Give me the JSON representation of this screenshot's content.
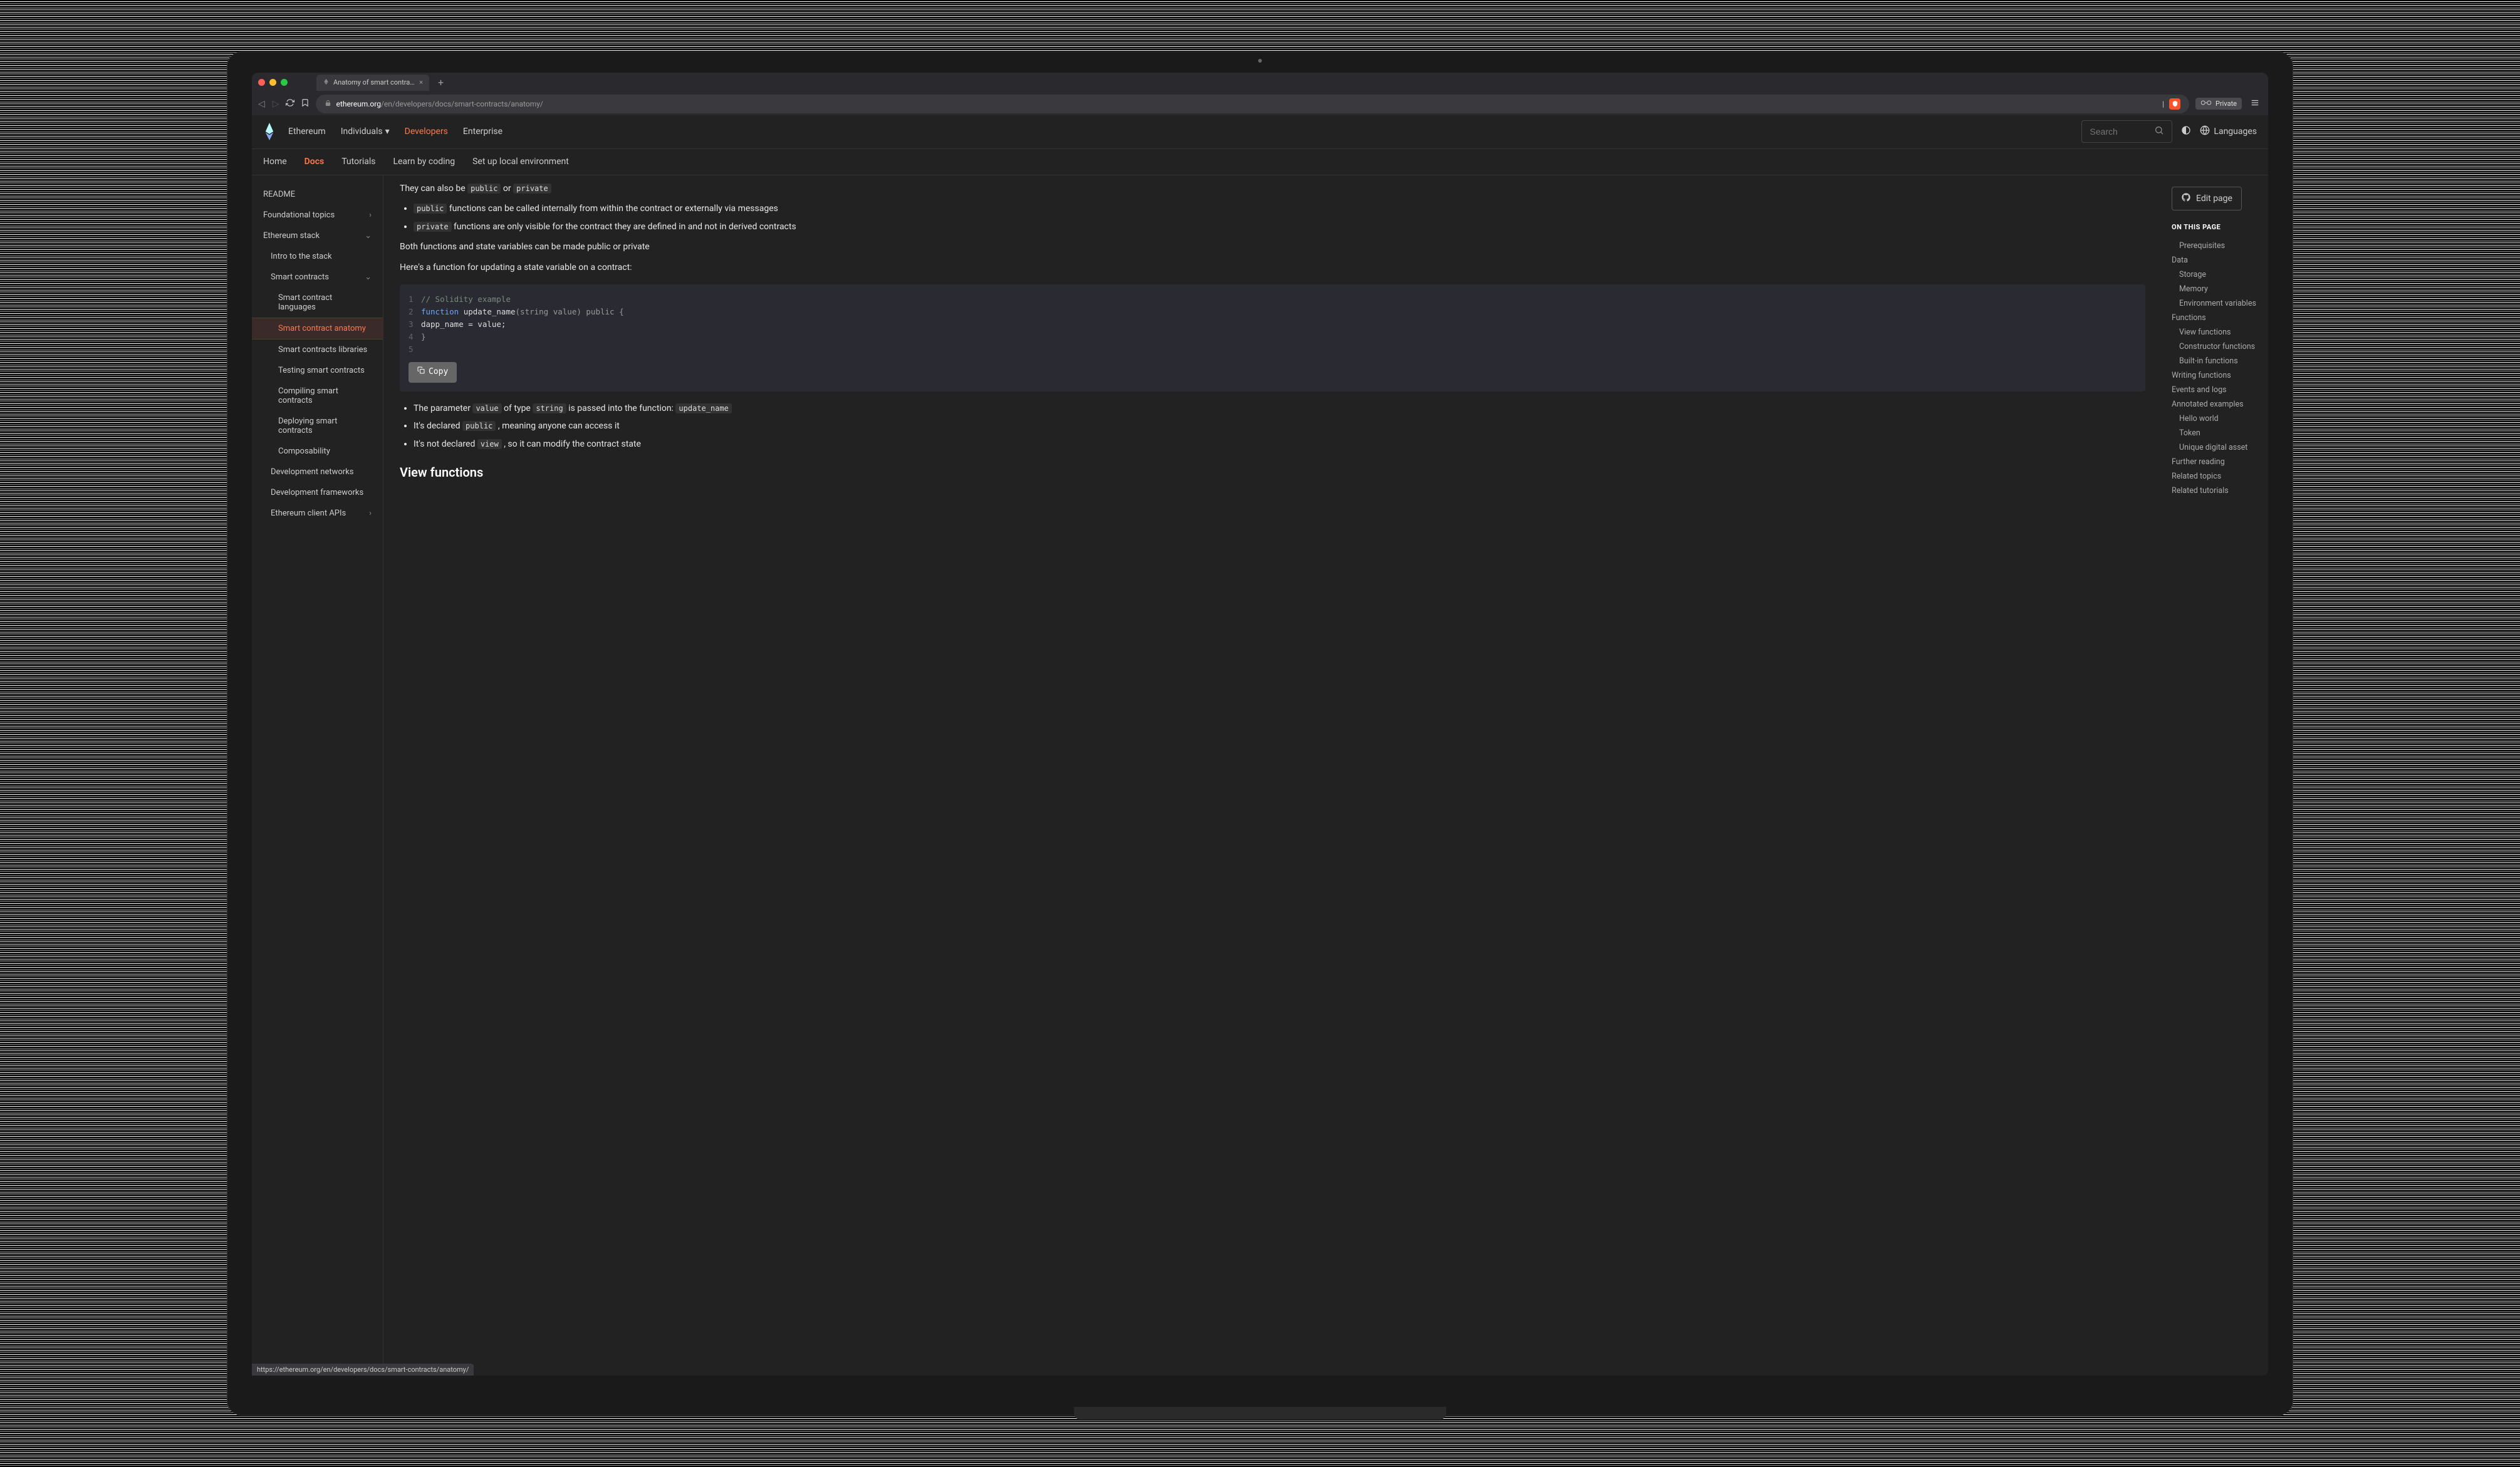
{
  "browser": {
    "tab_title": "Anatomy of smart contracts | et",
    "url_domain": "ethereum.org",
    "url_path": "/en/developers/docs/smart-contracts/anatomy/",
    "private_label": "Private",
    "status_url": "https://ethereum.org/en/developers/docs/smart-contracts/anatomy/"
  },
  "site_nav": {
    "items": [
      "Ethereum",
      "Individuals",
      "Developers",
      "Enterprise"
    ],
    "active_index": 2,
    "search_placeholder": "Search",
    "languages_label": "Languages"
  },
  "subnav": {
    "items": [
      "Home",
      "Docs",
      "Tutorials",
      "Learn by coding",
      "Set up local environment"
    ],
    "active_index": 1
  },
  "sidebar_left": [
    {
      "label": "README",
      "indent": 0,
      "chevron": false
    },
    {
      "label": "Foundational topics",
      "indent": 0,
      "chevron": "right"
    },
    {
      "label": "Ethereum stack",
      "indent": 0,
      "chevron": "down"
    },
    {
      "label": "Intro to the stack",
      "indent": 1,
      "chevron": false
    },
    {
      "label": "Smart contracts",
      "indent": 1,
      "chevron": "down"
    },
    {
      "label": "Smart contract languages",
      "indent": 2,
      "chevron": false
    },
    {
      "label": "Smart contract anatomy",
      "indent": 2,
      "chevron": false,
      "active": true
    },
    {
      "label": "Smart contracts libraries",
      "indent": 2,
      "chevron": false
    },
    {
      "label": "Testing smart contracts",
      "indent": 2,
      "chevron": false
    },
    {
      "label": "Compiling smart contracts",
      "indent": 2,
      "chevron": false
    },
    {
      "label": "Deploying smart contracts",
      "indent": 2,
      "chevron": false
    },
    {
      "label": "Composability",
      "indent": 2,
      "chevron": false
    },
    {
      "label": "Development networks",
      "indent": 1,
      "chevron": false
    },
    {
      "label": "Development frameworks",
      "indent": 1,
      "chevron": false
    },
    {
      "label": "Ethereum client APIs",
      "indent": 1,
      "chevron": "right"
    }
  ],
  "content": {
    "p_intro": "They can also be ",
    "code_public": "public",
    "p_intro_or": " or ",
    "code_private": "private",
    "li_public_text": " functions can be called internally from within the contract or externally via messages",
    "li_private_text": " functions are only visible for the contract they are defined in and not in derived contracts",
    "p_both": "Both functions and state variables can be made public or private",
    "p_update": "Here's a function for updating a state variable on a contract:",
    "code_lines": {
      "l1_comment": "// Solidity example",
      "l2_kw": "function",
      "l2_name": " update_name",
      "l2_sig": "(string value) public {",
      "l3": "    dapp_name = value;",
      "l4": "}"
    },
    "copy_label": "Copy",
    "li_param_1": "The parameter ",
    "li_param_value": "value",
    "li_param_2": " of type ",
    "li_param_string": "string",
    "li_param_3": " is passed into the function: ",
    "li_param_func": "update_name",
    "li_decl_1": "It's declared ",
    "li_decl_2": " , meaning anyone can access it",
    "li_view_1": "It's not declared ",
    "li_view_code": "view",
    "li_view_2": " , so it can modify the contract state",
    "next_heading": "View functions"
  },
  "right": {
    "edit_label": "Edit page",
    "toc_heading": "ON THIS PAGE",
    "toc": [
      {
        "label": "Prerequisites",
        "indent": 1
      },
      {
        "label": "Data",
        "indent": 0
      },
      {
        "label": "Storage",
        "indent": 1
      },
      {
        "label": "Memory",
        "indent": 1
      },
      {
        "label": "Environment variables",
        "indent": 1
      },
      {
        "label": "Functions",
        "indent": 0
      },
      {
        "label": "View functions",
        "indent": 1
      },
      {
        "label": "Constructor functions",
        "indent": 1
      },
      {
        "label": "Built-in functions",
        "indent": 1
      },
      {
        "label": "Writing functions",
        "indent": 0
      },
      {
        "label": "Events and logs",
        "indent": 0
      },
      {
        "label": "Annotated examples",
        "indent": 0
      },
      {
        "label": "Hello world",
        "indent": 1
      },
      {
        "label": "Token",
        "indent": 1
      },
      {
        "label": "Unique digital asset",
        "indent": 1
      },
      {
        "label": "Further reading",
        "indent": 0
      },
      {
        "label": "Related topics",
        "indent": 0
      },
      {
        "label": "Related tutorials",
        "indent": 0
      }
    ]
  }
}
